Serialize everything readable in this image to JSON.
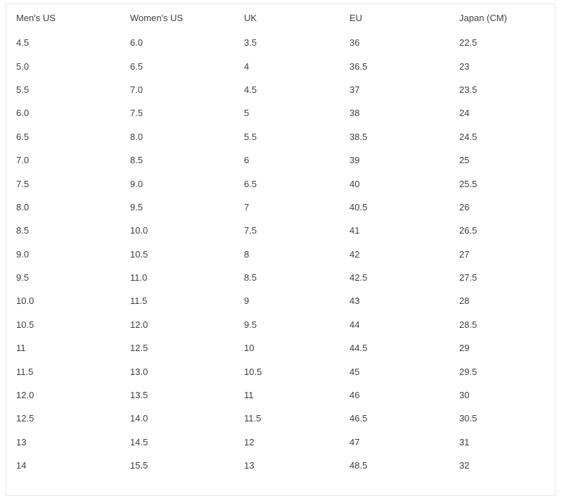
{
  "table": {
    "name": "shoe-size-conversion-table",
    "columns": [
      {
        "key": "mens_us",
        "label": "Men's US"
      },
      {
        "key": "womens_us",
        "label": "Women's US"
      },
      {
        "key": "uk",
        "label": "UK"
      },
      {
        "key": "eu",
        "label": "EU"
      },
      {
        "key": "japan_cm",
        "label": "Japan (CM)"
      }
    ],
    "rows": [
      {
        "mens_us": "4.5",
        "womens_us": "6.0",
        "uk": "3.5",
        "eu": "36",
        "japan_cm": "22.5"
      },
      {
        "mens_us": "5.0",
        "womens_us": "6.5",
        "uk": "4",
        "eu": "36.5",
        "japan_cm": "23"
      },
      {
        "mens_us": "5.5",
        "womens_us": "7.0",
        "uk": "4.5",
        "eu": "37",
        "japan_cm": "23.5"
      },
      {
        "mens_us": "6.0",
        "womens_us": "7.5",
        "uk": "5",
        "eu": "38",
        "japan_cm": "24"
      },
      {
        "mens_us": "6.5",
        "womens_us": "8.0",
        "uk": "5.5",
        "eu": "38.5",
        "japan_cm": "24.5"
      },
      {
        "mens_us": "7.0",
        "womens_us": "8.5",
        "uk": "6",
        "eu": "39",
        "japan_cm": "25"
      },
      {
        "mens_us": "7.5",
        "womens_us": "9.0",
        "uk": "6.5",
        "eu": "40",
        "japan_cm": "25.5"
      },
      {
        "mens_us": "8.0",
        "womens_us": "9.5",
        "uk": "7",
        "eu": "40.5",
        "japan_cm": "26"
      },
      {
        "mens_us": "8.5",
        "womens_us": "10.0",
        "uk": "7.5",
        "eu": "41",
        "japan_cm": "26.5"
      },
      {
        "mens_us": "9.0",
        "womens_us": "10.5",
        "uk": "8",
        "eu": "42",
        "japan_cm": "27"
      },
      {
        "mens_us": "9.5",
        "womens_us": "11.0",
        "uk": "8.5",
        "eu": "42.5",
        "japan_cm": "27.5"
      },
      {
        "mens_us": "10.0",
        "womens_us": "11.5",
        "uk": "9",
        "eu": "43",
        "japan_cm": "28"
      },
      {
        "mens_us": "10.5",
        "womens_us": "12.0",
        "uk": "9.5",
        "eu": "44",
        "japan_cm": "28.5"
      },
      {
        "mens_us": "11",
        "womens_us": "12.5",
        "uk": "10",
        "eu": "44.5",
        "japan_cm": "29"
      },
      {
        "mens_us": "11.5",
        "womens_us": "13.0",
        "uk": "10.5",
        "eu": "45",
        "japan_cm": "29.5"
      },
      {
        "mens_us": "12.0",
        "womens_us": "13.5",
        "uk": "11",
        "eu": "46",
        "japan_cm": "30"
      },
      {
        "mens_us": "12.5",
        "womens_us": "14.0",
        "uk": "11.5",
        "eu": "46.5",
        "japan_cm": "30.5"
      },
      {
        "mens_us": "13",
        "womens_us": "14.5",
        "uk": "12",
        "eu": "47",
        "japan_cm": "31"
      },
      {
        "mens_us": "14",
        "womens_us": "15.5",
        "uk": "13",
        "eu": "48.5",
        "japan_cm": "32"
      }
    ]
  },
  "colors": {
    "text": "#3c4043",
    "border": "#e6e6e6",
    "background": "#ffffff"
  }
}
